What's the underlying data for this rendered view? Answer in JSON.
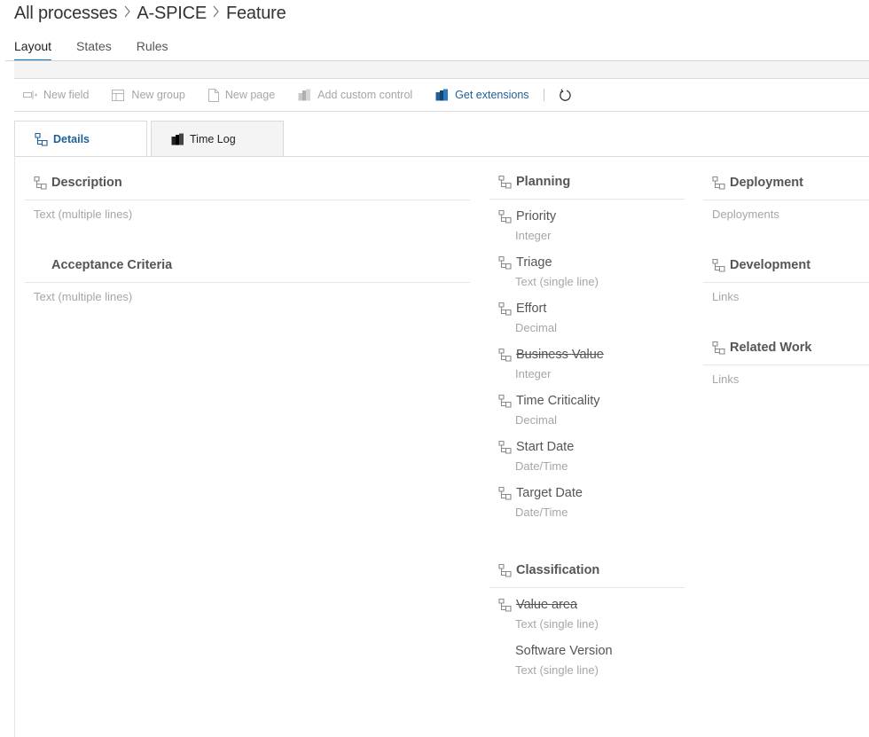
{
  "breadcrumb": {
    "root": "All processes",
    "process": "A-SPICE",
    "workitem": "Feature"
  },
  "tabs": [
    {
      "label": "Layout"
    },
    {
      "label": "States"
    },
    {
      "label": "Rules"
    }
  ],
  "toolbar": {
    "new_field": "New field",
    "new_group": "New group",
    "new_page": "New page",
    "add_custom_control": "Add custom control",
    "get_extensions": "Get extensions"
  },
  "pages": [
    {
      "label": "Details"
    },
    {
      "label": "Time Log"
    }
  ],
  "left_groups": {
    "description": {
      "title": "Description",
      "placeholder": "Text (multiple lines)"
    },
    "acceptance": {
      "title": "Acceptance Criteria",
      "placeholder": "Text (multiple lines)"
    }
  },
  "planning": {
    "title": "Planning",
    "fields": [
      {
        "name": "Priority",
        "type": "Integer"
      },
      {
        "name": "Triage",
        "type": "Text (single line)"
      },
      {
        "name": "Effort",
        "type": "Decimal"
      },
      {
        "name": "Business Value",
        "type": "Integer"
      },
      {
        "name": "Time Criticality",
        "type": "Decimal"
      },
      {
        "name": "Start Date",
        "type": "Date/Time"
      },
      {
        "name": "Target Date",
        "type": "Date/Time"
      }
    ]
  },
  "classification": {
    "title": "Classification",
    "fields": [
      {
        "name": "Value area",
        "type": "Text (single line)"
      },
      {
        "name": "Software Version",
        "type": "Text (single line)"
      }
    ]
  },
  "right_groups": {
    "deployment": {
      "title": "Deployment",
      "placeholder": "Deployments"
    },
    "development": {
      "title": "Development",
      "placeholder": "Links"
    },
    "related": {
      "title": "Related Work",
      "placeholder": "Links"
    }
  },
  "colors": {
    "accent": "#0078d4",
    "link": "#1f5f96",
    "muted": "#a6a6a6",
    "text": "#555555"
  }
}
